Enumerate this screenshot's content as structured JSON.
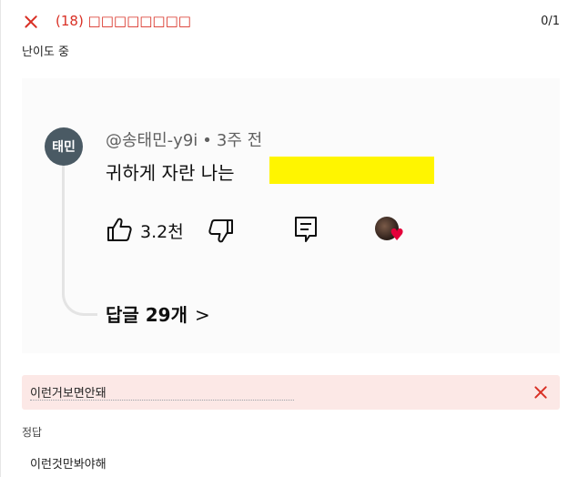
{
  "header": {
    "title": "(18) □□□□□□□□",
    "progress": "0/1"
  },
  "difficulty": "난이도 중",
  "comment": {
    "avatar_text": "태민",
    "author": "@송태민-y9i",
    "time": "3주 전",
    "text": "귀하게 자란 나는",
    "like_count": "3.2천",
    "replies_label": "답글 29개",
    "highlight_color": "#fff500"
  },
  "answer": {
    "user_answer": "이런거보면안돼",
    "status": "wrong",
    "status_color": "#d93025",
    "correct_label": "정답",
    "correct_answer": "이런것만봐야해"
  }
}
